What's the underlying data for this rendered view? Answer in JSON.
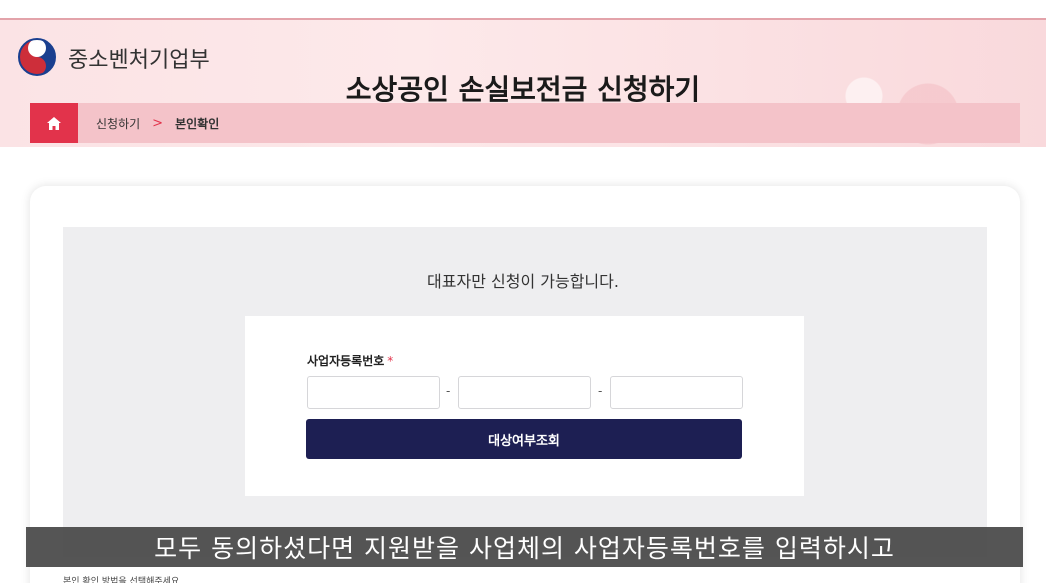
{
  "header": {
    "ministry": "중소벤처기업부",
    "title": "소상공인 손실보전금 신청하기"
  },
  "breadcrumb": {
    "step1": "신청하기",
    "separator": ">",
    "step2": "본인확인"
  },
  "main": {
    "notice": "대표자만 신청이 가능합니다.",
    "field_label": "사업자등록번호",
    "required_mark": "*",
    "dash": "-",
    "submit_label": "대상여부조회"
  },
  "caption": "모두 동의하셨다면 지원받을 사업체의 사업자등록번호를 입력하시고",
  "bottom_text": "본인 확인 방법을 선택해주세요",
  "colors": {
    "accent_red": "#e2334b",
    "navy": "#1d1f53",
    "header_pink": "#fbe3e5"
  },
  "icons": {
    "logo": "korea-government-emblem-icon",
    "home": "home-icon"
  }
}
